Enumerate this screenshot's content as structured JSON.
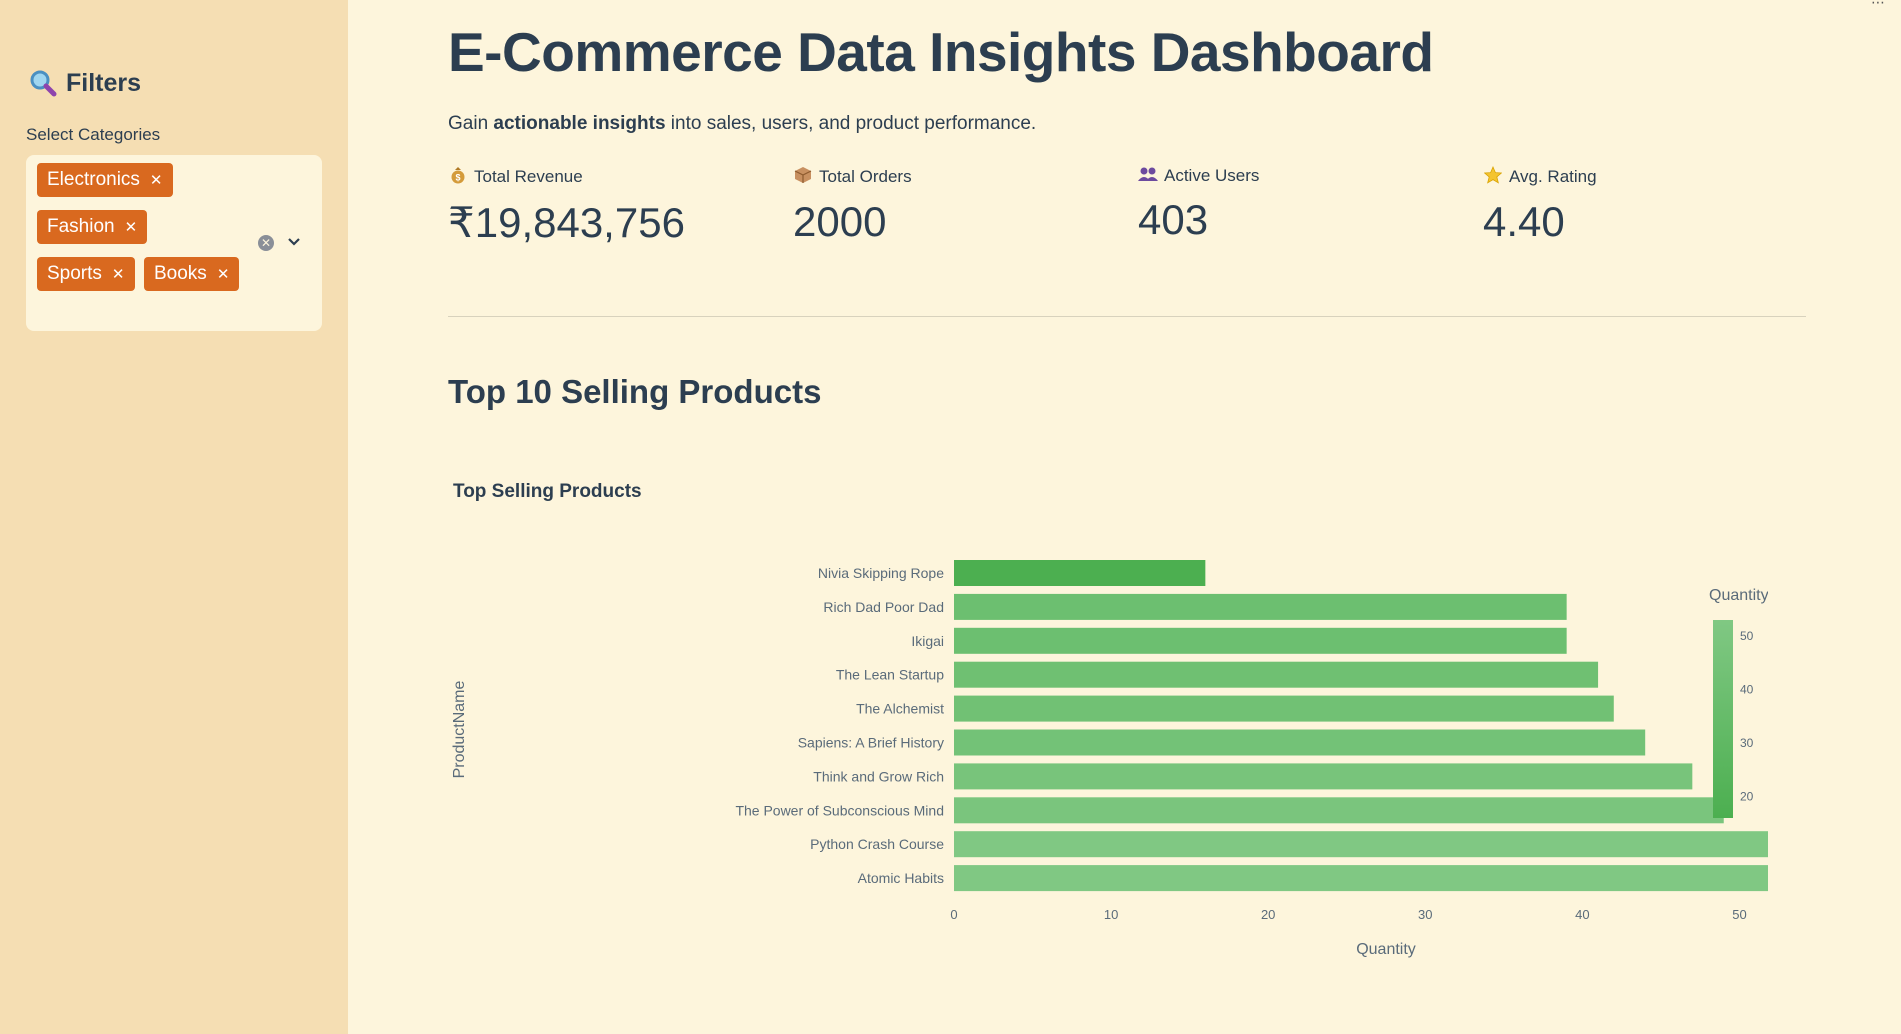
{
  "sidebar": {
    "title": "Filters",
    "title_icon": "magnifier-icon",
    "filter_label": "Select Categories",
    "chips": [
      "Electronics",
      "Fashion",
      "Sports",
      "Books"
    ],
    "chip_color": "#d9691f"
  },
  "header": {
    "title": "E-Commerce Data Insights Dashboard",
    "subtitle_pre": "Gain ",
    "subtitle_bold": "actionable insights",
    "subtitle_post": " into sales, users, and product performance."
  },
  "metrics": [
    {
      "icon": "money-bag-icon",
      "label": "Total Revenue",
      "value": "₹19,843,756"
    },
    {
      "icon": "package-icon",
      "label": "Total Orders",
      "value": "2000"
    },
    {
      "icon": "users-icon",
      "label": "Active Users",
      "value": "403"
    },
    {
      "icon": "star-icon",
      "label": "Avg. Rating",
      "value": "4.40"
    }
  ],
  "section": {
    "title": "Top 10 Selling Products"
  },
  "chart_data": {
    "type": "bar",
    "orientation": "horizontal",
    "title": "Top Selling Products",
    "xlabel": "Quantity",
    "ylabel": "ProductName",
    "xlim": [
      0,
      55
    ],
    "x_ticks": [
      0,
      10,
      20,
      30,
      40,
      50
    ],
    "categories": [
      "Nivia Skipping Rope",
      "Rich Dad Poor Dad",
      "Ikigai",
      "The Lean Startup",
      "The Alchemist",
      "Sapiens: A Brief History",
      "Think and Grow Rich",
      "The Power of Subconscious Mind",
      "Python Crash Course",
      "Atomic Habits"
    ],
    "values": [
      16,
      39,
      39,
      41,
      42,
      44,
      47,
      49,
      53,
      53
    ],
    "colorbar": {
      "title": "Quantity",
      "ticks": [
        50,
        40,
        30,
        20
      ],
      "range": [
        16,
        53
      ],
      "color_low": "#4caf50",
      "color_high": "#80c883"
    },
    "grid": false,
    "legend": "right"
  }
}
